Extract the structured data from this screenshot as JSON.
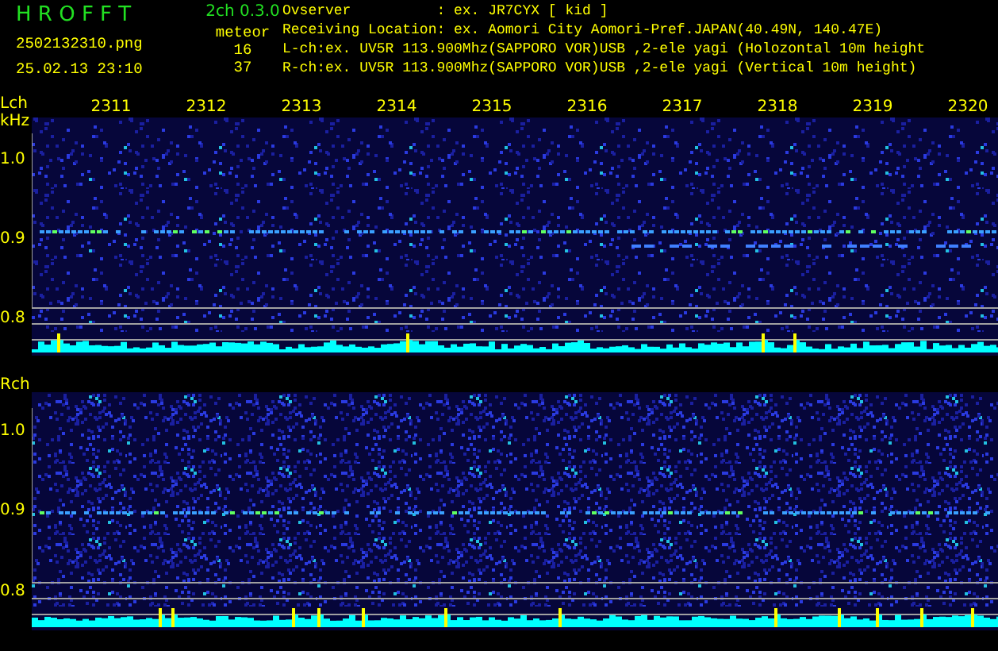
{
  "app": {
    "title": "H R O F F T",
    "version": "2ch 0.3.0",
    "file": "2502132310.png",
    "datetime": "25.02.13 23:10",
    "counter_label": "meteor",
    "counts": [
      "16",
      "37"
    ]
  },
  "info": [
    {
      "kind": "field",
      "label": "Ovserver",
      "value": ": ex. JR7CYX [ kid ]"
    },
    {
      "kind": "field",
      "label": "Receiving Location",
      "value": ": ex. Aomori City Aomori-Pref.JAPAN(40.49N, 140.47E)"
    },
    {
      "kind": "line",
      "text": "L-ch:ex. UV5R 113.900Mhz(SAPPORO VOR)USB ,2-ele yagi (Holozontal 10m height"
    },
    {
      "kind": "line",
      "text": "R-ch:ex. UV5R 113.900Mhz(SAPPORO VOR)USB ,2-ele yagi (Vertical 10m height)"
    }
  ],
  "channels": [
    {
      "label": "Lch",
      "unit": "kHz",
      "time_ticks": [
        "2311",
        "2312",
        "2313",
        "2314",
        "2315",
        "2316",
        "2317",
        "2318",
        "2319",
        "2320"
      ],
      "freq_ticks": [
        "1.0",
        "0.9",
        "0.8"
      ]
    },
    {
      "label": "Rch",
      "freq_ticks": [
        "1.0",
        "0.9",
        "0.8"
      ]
    }
  ]
}
